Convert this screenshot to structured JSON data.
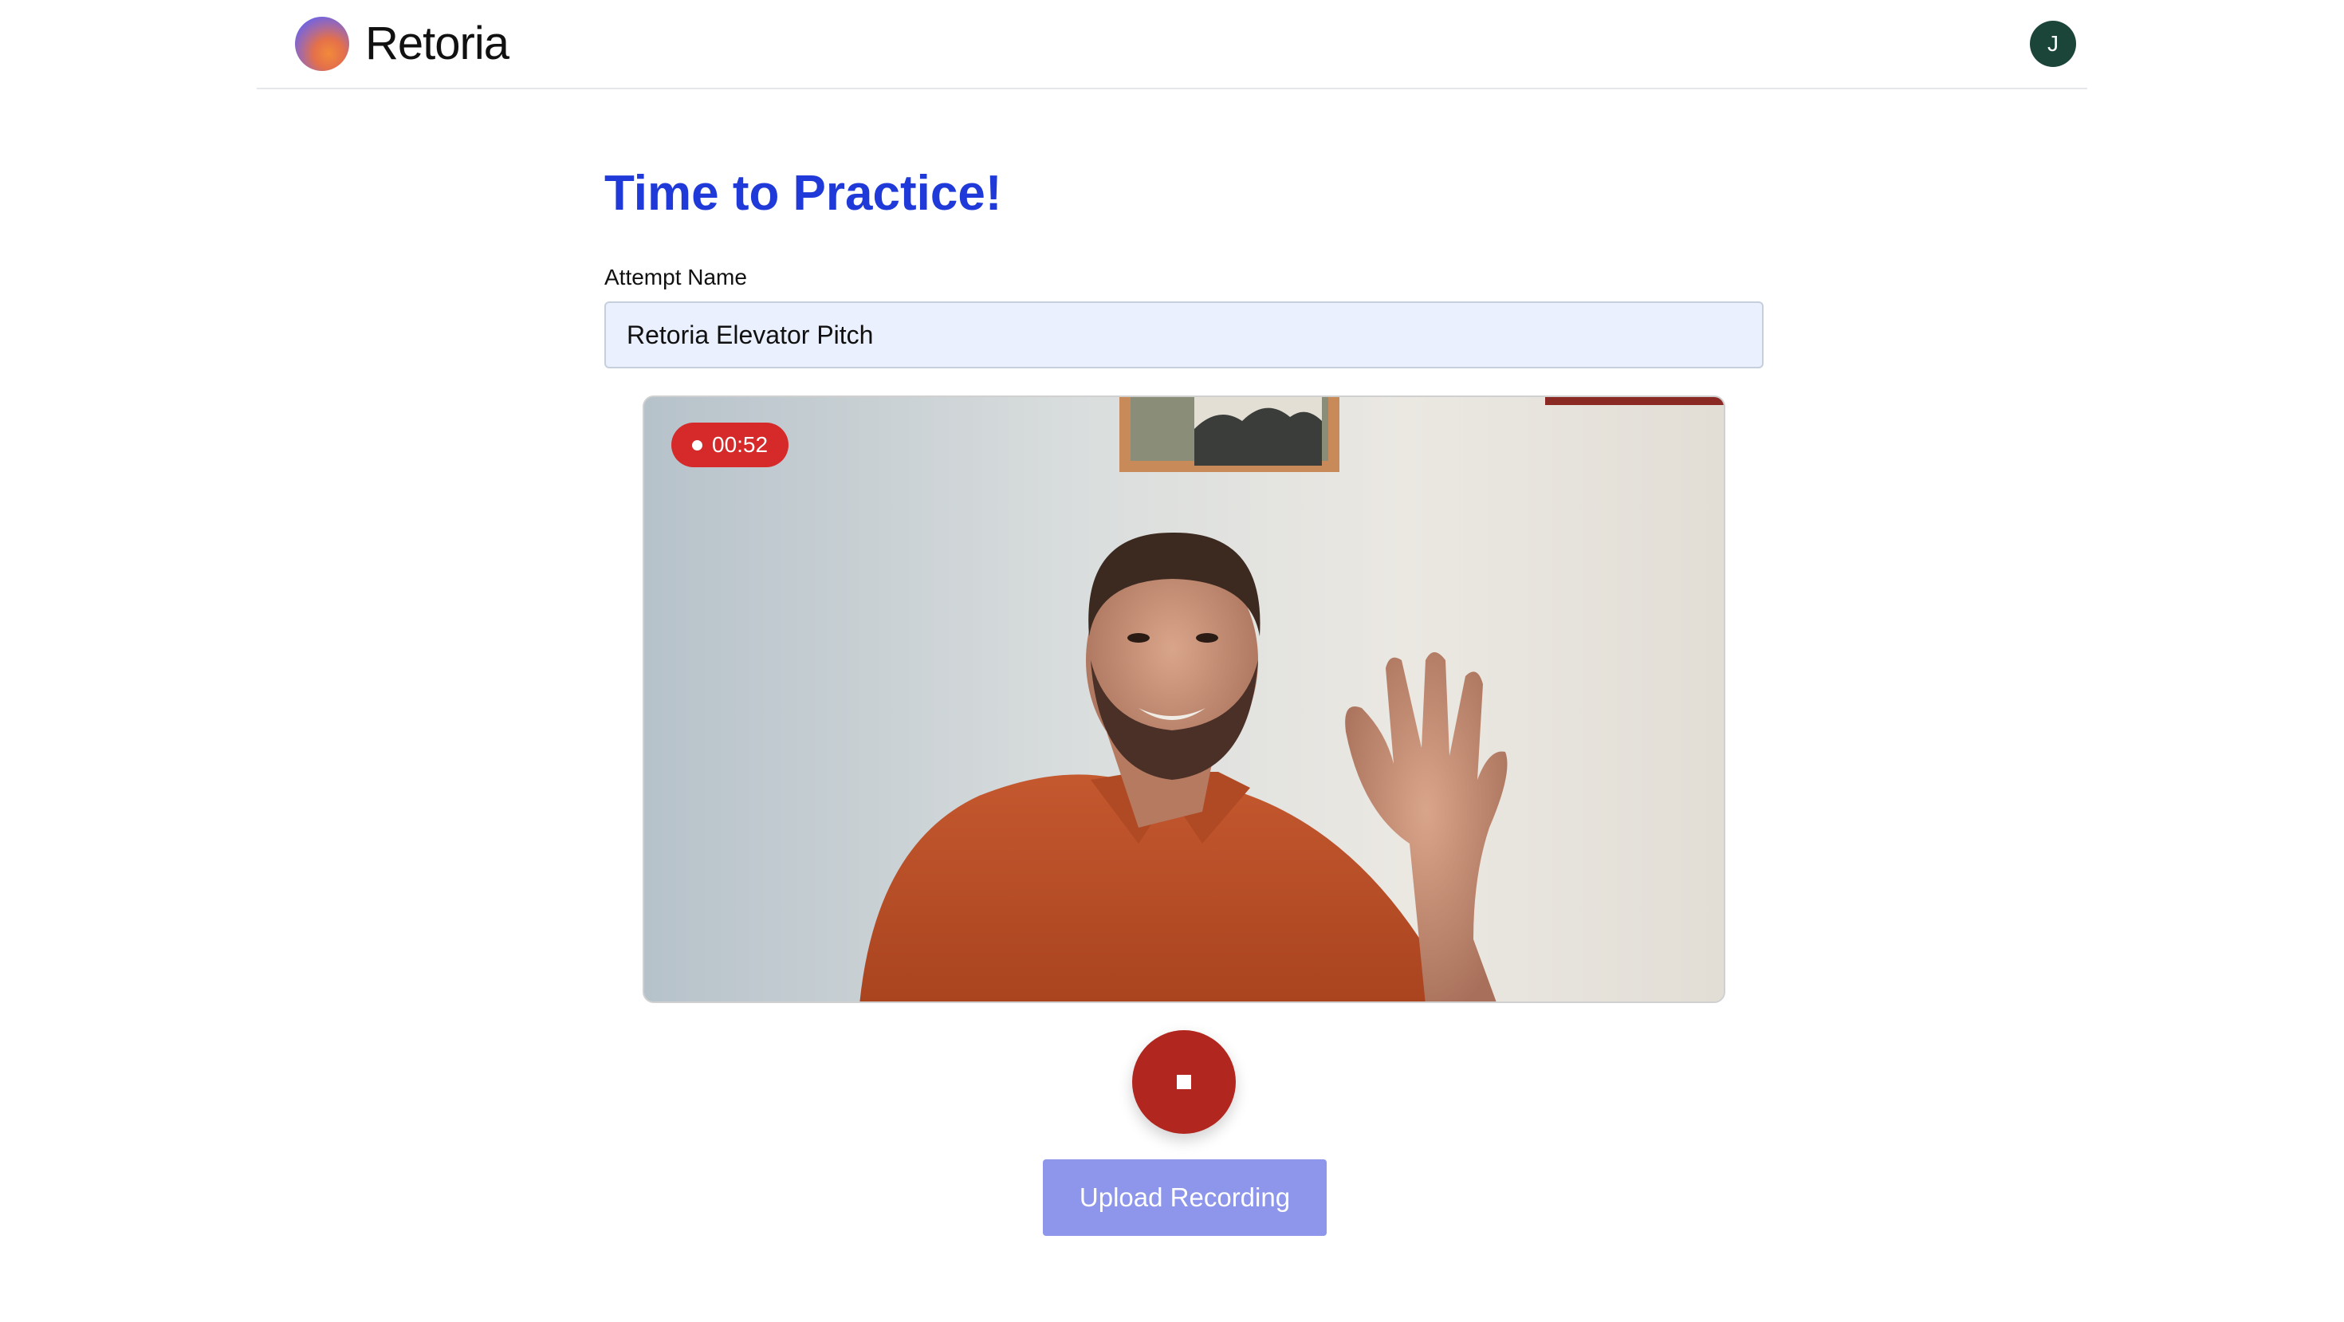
{
  "header": {
    "brand_name": "Retoria",
    "logo_icon": "retoria-logo-icon",
    "avatar_initial": "J",
    "avatar_color": "#1b4539"
  },
  "main": {
    "title": "Time to Practice!",
    "title_color": "#1f3ad8",
    "attempt_name_label": "Attempt Name",
    "attempt_name_value": "Retoria Elevator Pitch",
    "video": {
      "recording_indicator_icon": "record-dot-icon",
      "recording_time": "00:52",
      "recording_badge_color": "#d62a2a"
    },
    "stop_button_icon": "stop-icon",
    "stop_button_color": "#b1271f",
    "upload_button_label": "Upload Recording",
    "upload_button_color": "#8d96ea"
  }
}
